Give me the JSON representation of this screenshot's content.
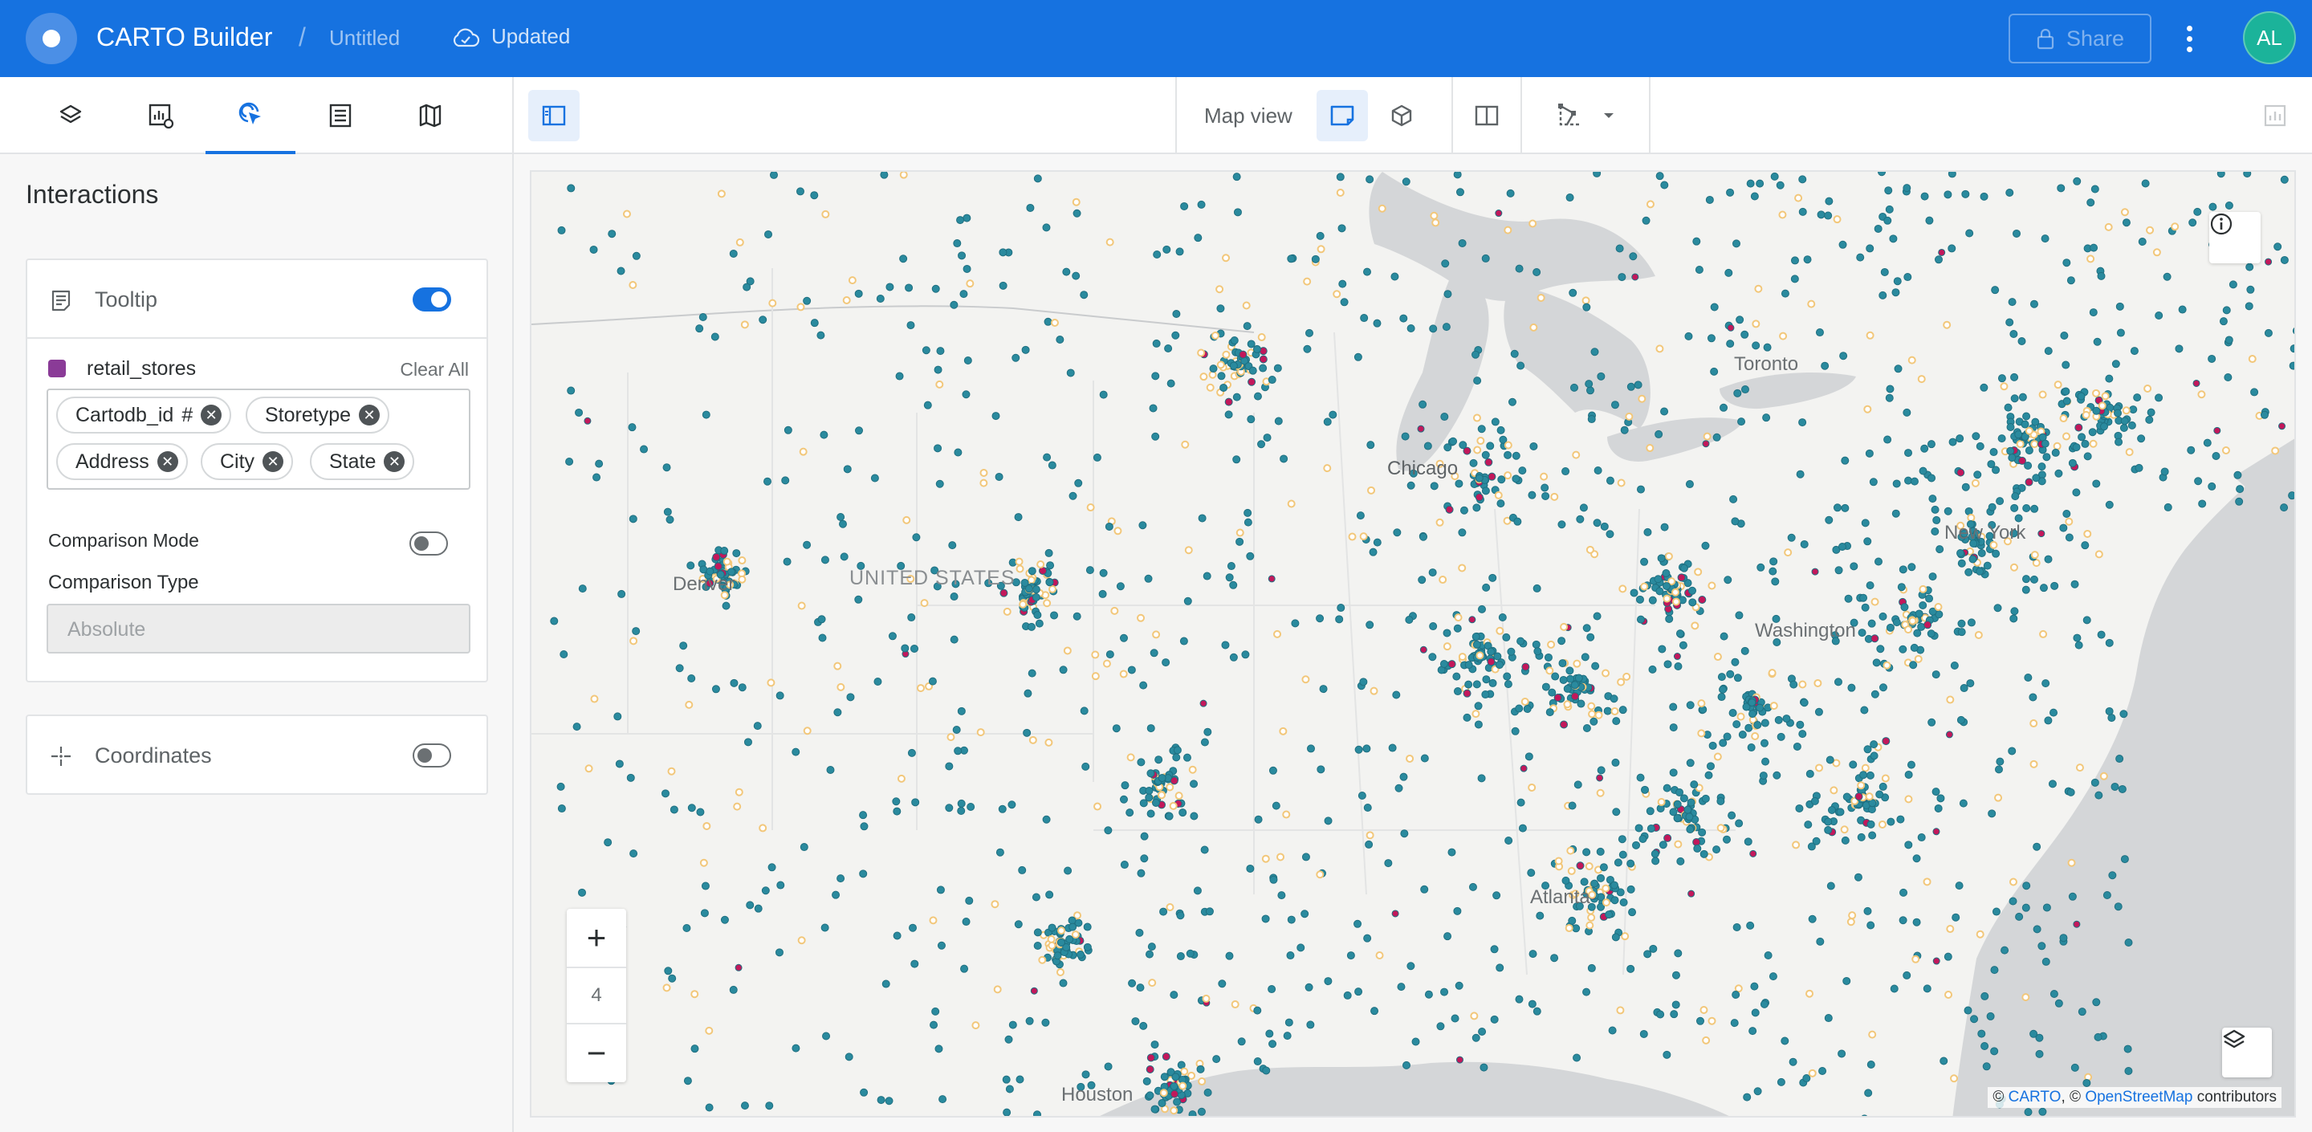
{
  "app": {
    "title": "CARTO Builder",
    "separator": "/",
    "map_name": "Untitled",
    "save_status": "Updated",
    "share_label": "Share",
    "user_initials": "AL",
    "brand_color": "#1672e0"
  },
  "toolbar": {
    "tabs": [
      {
        "icon": "layers-icon",
        "name": "Layers"
      },
      {
        "icon": "widgets-icon",
        "name": "Widgets"
      },
      {
        "icon": "interactions-icon",
        "name": "Interactions",
        "active": true
      },
      {
        "icon": "legend-icon",
        "name": "Legend"
      },
      {
        "icon": "basemap-icon",
        "name": "Basemap"
      }
    ],
    "map_view_label": "Map view"
  },
  "panel": {
    "title": "Interactions",
    "tooltip": {
      "label": "Tooltip",
      "enabled": true,
      "layer_name": "retail_stores",
      "layer_color": "#8a3b97",
      "clear_all_label": "Clear All",
      "fields": [
        {
          "label": "Cartodb_id",
          "suffix": "#"
        },
        {
          "label": "Storetype",
          "suffix": ""
        },
        {
          "label": "Address",
          "suffix": ""
        },
        {
          "label": "City",
          "suffix": ""
        },
        {
          "label": "State",
          "suffix": ""
        }
      ],
      "comparison_mode_label": "Comparison Mode",
      "comparison_mode_enabled": false,
      "comparison_type_label": "Comparison Type",
      "comparison_type_value": "Absolute"
    },
    "coordinates": {
      "label": "Coordinates",
      "enabled": false
    }
  },
  "map": {
    "labels": {
      "toronto": "Toronto",
      "chicago": "Chicago",
      "denver": "Denver",
      "united_states": "UNITED STATES",
      "washington": "Washington",
      "new_york": "New York",
      "atlanta": "Atlanta",
      "houston": "Houston"
    },
    "zoom_level": "4",
    "zoom_in": "+",
    "zoom_out": "−",
    "attribution_prefix": "© ",
    "attribution_carto": "CARTO",
    "attribution_mid": ", © ",
    "attribution_osm": "OpenStreetMap",
    "attribution_suffix": " contributors",
    "point_colors": {
      "primary": "#2a8a9e",
      "secondary": "#f2c77a",
      "tertiary": "#c2185b"
    }
  }
}
